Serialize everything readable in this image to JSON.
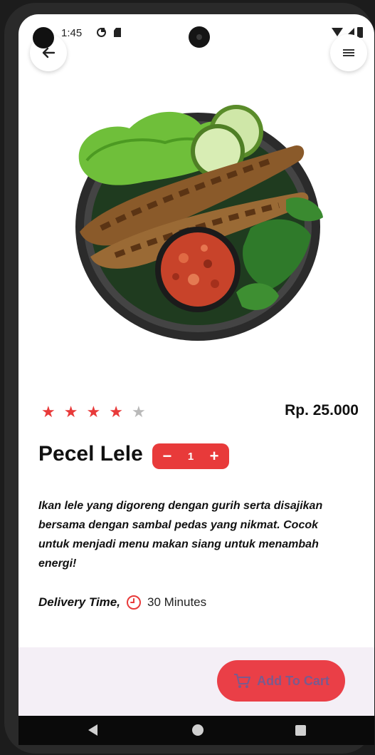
{
  "status_bar": {
    "time": "1:45"
  },
  "product": {
    "rating": 4,
    "rating_max": 5,
    "price": "Rp. 25.000",
    "name": "Pecel Lele",
    "quantity": "1",
    "description": "Ikan lele yang digoreng dengan gurih serta disajikan bersama dengan sambal pedas yang nikmat. Cocok untuk menjadi menu makan siang untuk menambah energi!",
    "delivery_label": "Delivery Time,",
    "delivery_value": "30 Minutes"
  },
  "cart": {
    "label": "Add To Cart"
  },
  "icons": {
    "back": "arrow-left-icon",
    "menu": "hamburger-menu-icon",
    "clock": "clock-icon",
    "cart": "cart-icon",
    "star": "star-icon"
  },
  "colors": {
    "accent": "#e83a3a",
    "star_off": "#b9b9b9",
    "cart_label": "#7b5a8e",
    "bottom_bg": "#f4eff6"
  }
}
